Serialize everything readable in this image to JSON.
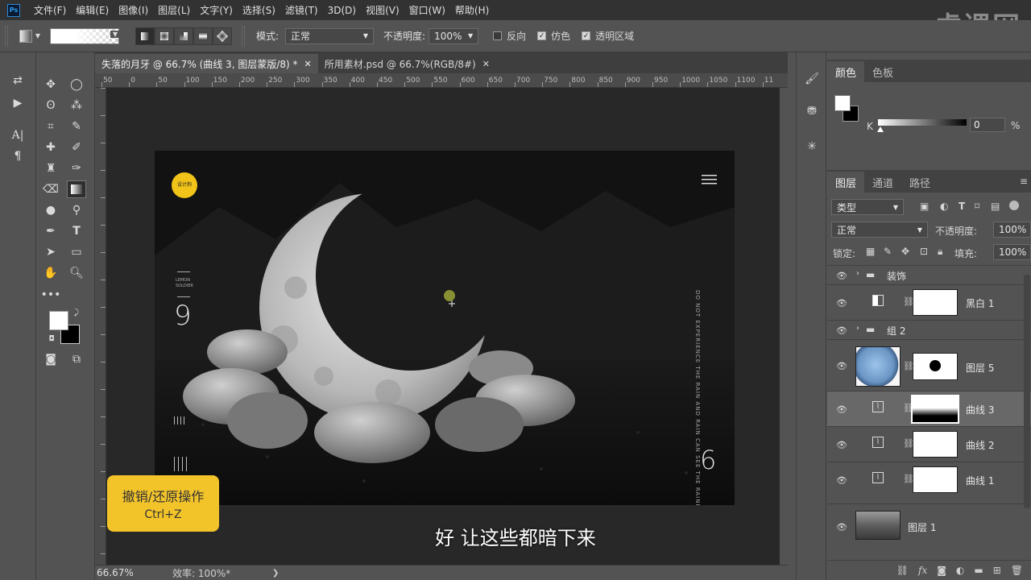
{
  "menu": {
    "items": [
      "文件(F)",
      "编辑(E)",
      "图像(I)",
      "图层(L)",
      "文字(Y)",
      "选择(S)",
      "滤镜(T)",
      "3D(D)",
      "视图(V)",
      "窗口(W)",
      "帮助(H)"
    ],
    "brand": "虎课网"
  },
  "options": {
    "mode_label": "模式:",
    "mode_value": "正常",
    "opacity_label": "不透明度:",
    "opacity_value": "100%",
    "reverse_label": "反向",
    "dither_label": "仿色",
    "transparency_label": "透明区域"
  },
  "tabs": [
    {
      "label": "失落的月牙 @ 66.7% (曲线 3, 图层蒙版/8) *"
    },
    {
      "label": "所用素材.psd @ 66.7%(RGB/8#)"
    }
  ],
  "ruler": {
    "top": [
      "50",
      "0",
      "50",
      "100",
      "150",
      "200",
      "250",
      "300",
      "350",
      "400",
      "450",
      "500",
      "550",
      "600",
      "650",
      "700",
      "750",
      "800",
      "850",
      "900",
      "950",
      "1000",
      "1050",
      "1100",
      "11"
    ]
  },
  "status": {
    "zoom": "66.67%",
    "efficiency": "效率: 100%*"
  },
  "artwork": {
    "logo_text": "设计狗",
    "left_small": "LEMON SOLDIER",
    "left_number": "9",
    "right_vertical": "DO NOT EXPERIENCE THE RAIN AND RAIN CAN SEE THE RAINBOW",
    "bottom_number": "6"
  },
  "tip": {
    "title": "撤销/还原操作",
    "shortcut": "Ctrl+Z"
  },
  "subtitle": "好 让这些都暗下来",
  "color_panel": {
    "tabs": [
      "颜色",
      "色板"
    ],
    "channel": "K",
    "value": "0",
    "unit": "%"
  },
  "layers_panel": {
    "tabs": [
      "图层",
      "通道",
      "路径"
    ],
    "filter": "类型",
    "blend": "正常",
    "opacity_label": "不透明度:",
    "opacity_value": "100%",
    "lock_label": "锁定:",
    "fill_label": "填充:",
    "fill_value": "100%",
    "layers": [
      {
        "name": "装饰"
      },
      {
        "name": "黑白 1"
      },
      {
        "name": "组 2"
      },
      {
        "name": "图层 5"
      },
      {
        "name": "曲线 3"
      },
      {
        "name": "曲线 2"
      },
      {
        "name": "曲线 1"
      },
      {
        "name": "图层 1"
      }
    ]
  }
}
